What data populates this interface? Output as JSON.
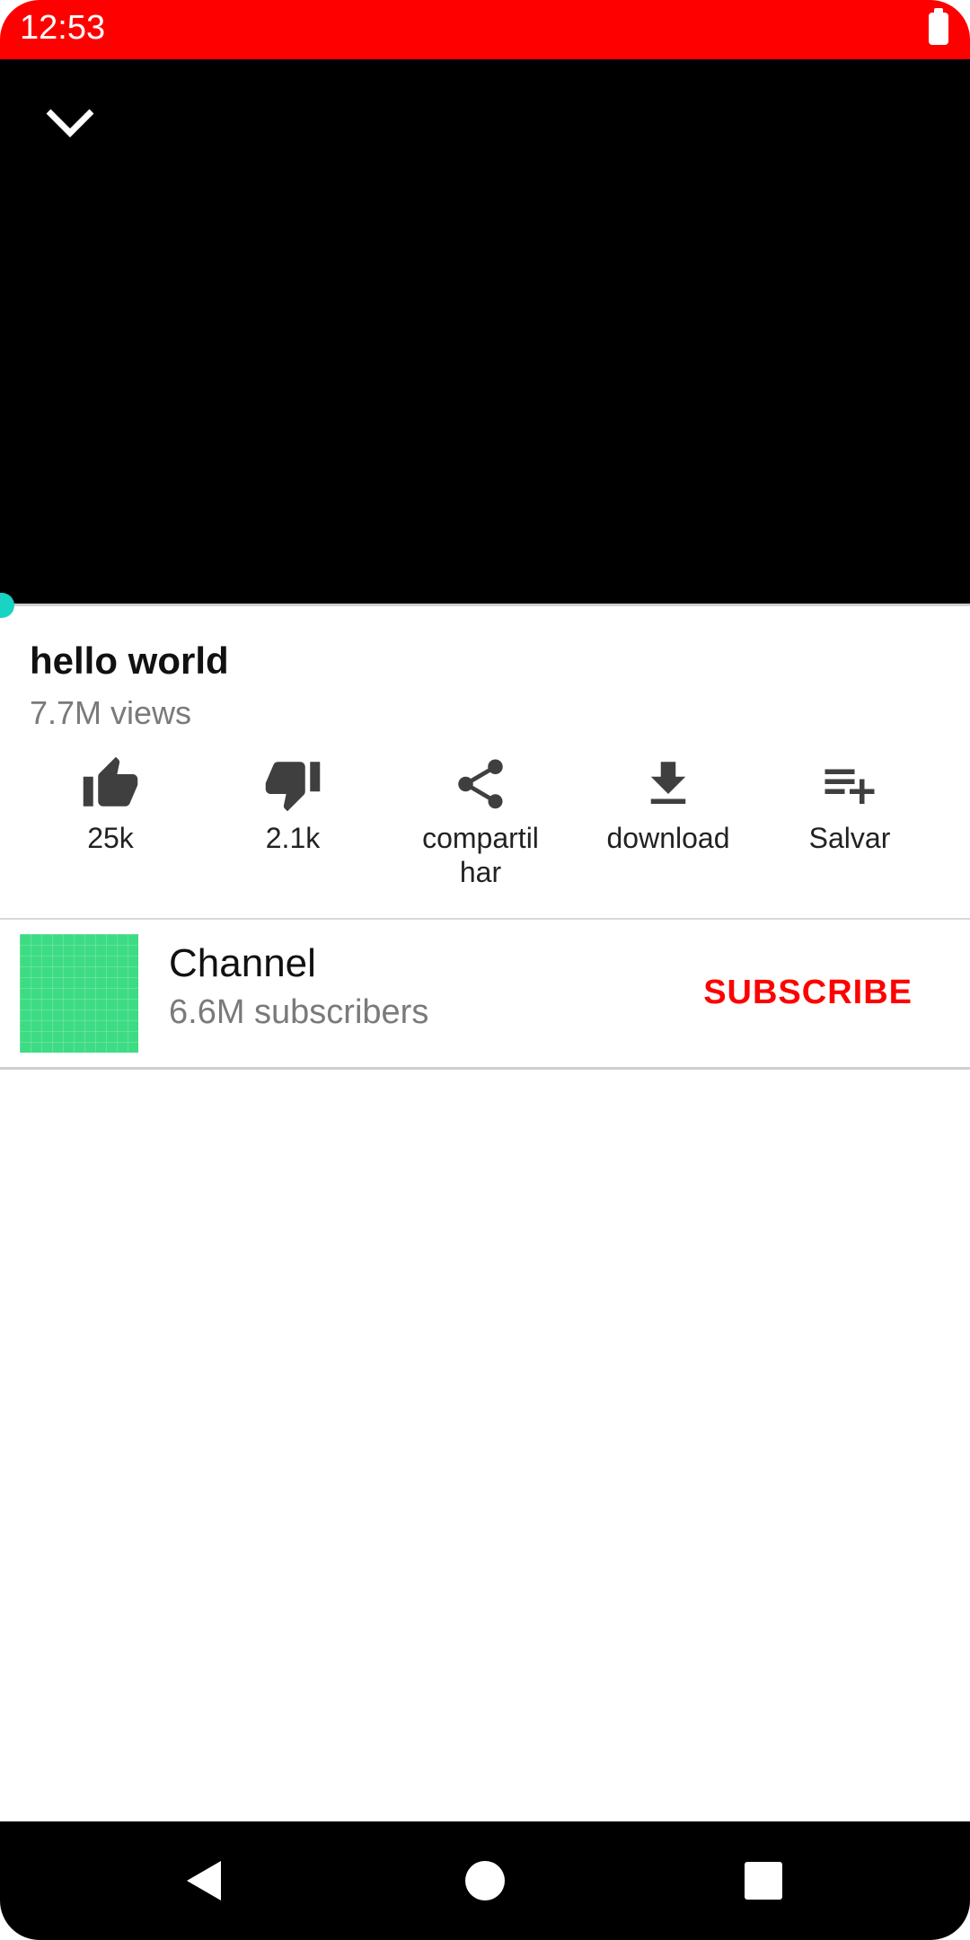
{
  "status_bar": {
    "time": "12:53",
    "battery_icon": "battery-icon",
    "color": "#ff0000"
  },
  "player": {
    "collapse_icon": "chevron-down-icon",
    "progress": 0
  },
  "video": {
    "title": "hello world",
    "views": "7.7M views"
  },
  "actions": [
    {
      "icon": "thumbs-up-icon",
      "label": "25k"
    },
    {
      "icon": "thumbs-down-icon",
      "label": "2.1k"
    },
    {
      "icon": "share-icon",
      "label": "compartil\nhar"
    },
    {
      "icon": "download-icon",
      "label": "download"
    },
    {
      "icon": "playlist-add-icon",
      "label": "Salvar"
    }
  ],
  "channel": {
    "name": "Channel",
    "subscribers": "6.6M subscribers",
    "subscribe_label": "SUBSCRIBE",
    "avatar_color": "#3ddc84",
    "accent_color": "#ff0000"
  },
  "nav_bar": {
    "back_icon": "back-triangle-icon",
    "home_icon": "home-circle-icon",
    "recents_icon": "recents-square-icon"
  }
}
